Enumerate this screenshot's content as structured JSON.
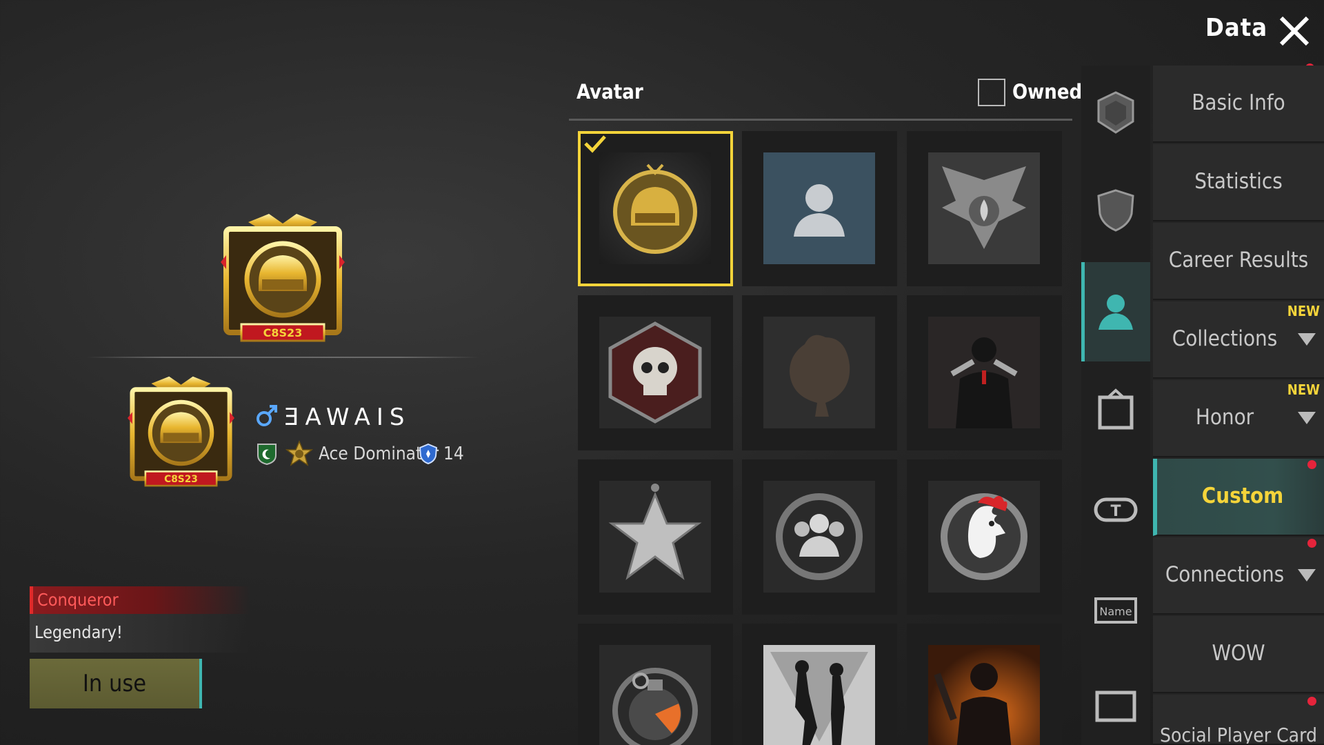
{
  "header": {
    "title": "Data"
  },
  "profile": {
    "player_name": "ƎAWAIS",
    "tier_name": "Ace Dominator",
    "level": "14",
    "frame_label": "C8S23",
    "title": "Conqueror",
    "motto": "Legendary!",
    "use_button": "In use"
  },
  "avatar_panel": {
    "header": "Avatar",
    "owned_filter_label": "Owned",
    "owned_checked": false,
    "items": [
      {
        "icon": "helmet-avatar",
        "selected": true
      },
      {
        "icon": "default-user-avatar",
        "selected": false
      },
      {
        "icon": "winged-emblem-avatar",
        "selected": false
      },
      {
        "icon": "skull-hexagon-avatar",
        "selected": false
      },
      {
        "icon": "chicken-silhouette-avatar",
        "selected": false
      },
      {
        "icon": "dual-pistols-avatar",
        "selected": false
      },
      {
        "icon": "star-medal-avatar",
        "selected": false
      },
      {
        "icon": "squad-emblem-avatar",
        "selected": false
      },
      {
        "icon": "rooster-emblem-avatar",
        "selected": false
      },
      {
        "icon": "grenade-avatar",
        "selected": false
      },
      {
        "icon": "duo-fighters-avatar",
        "selected": false
      },
      {
        "icon": "soldier-fire-avatar",
        "selected": false
      }
    ]
  },
  "side_icons": [
    {
      "name": "emblem-icon"
    },
    {
      "name": "shield-icon"
    },
    {
      "name": "avatar-icon",
      "active": true
    },
    {
      "name": "frame-icon"
    },
    {
      "name": "title-badge-icon"
    },
    {
      "name": "nameplate-icon"
    },
    {
      "name": "card-icon"
    }
  ],
  "menu": [
    {
      "label": "Basic Info"
    },
    {
      "label": "Statistics"
    },
    {
      "label": "Career Results"
    },
    {
      "label": "Collections",
      "badge": "NEW",
      "arrow": true
    },
    {
      "label": "Honor",
      "badge": "NEW",
      "arrow": true
    },
    {
      "label": "Custom",
      "active": true
    },
    {
      "label": "Connections",
      "arrow": true
    },
    {
      "label": "WOW"
    },
    {
      "label": "Social Player Card"
    }
  ],
  "colors": {
    "accent": "#3fb6b0",
    "highlight": "#f5d43a",
    "alert": "#e5243b",
    "title_red": "#ff5a5a"
  }
}
